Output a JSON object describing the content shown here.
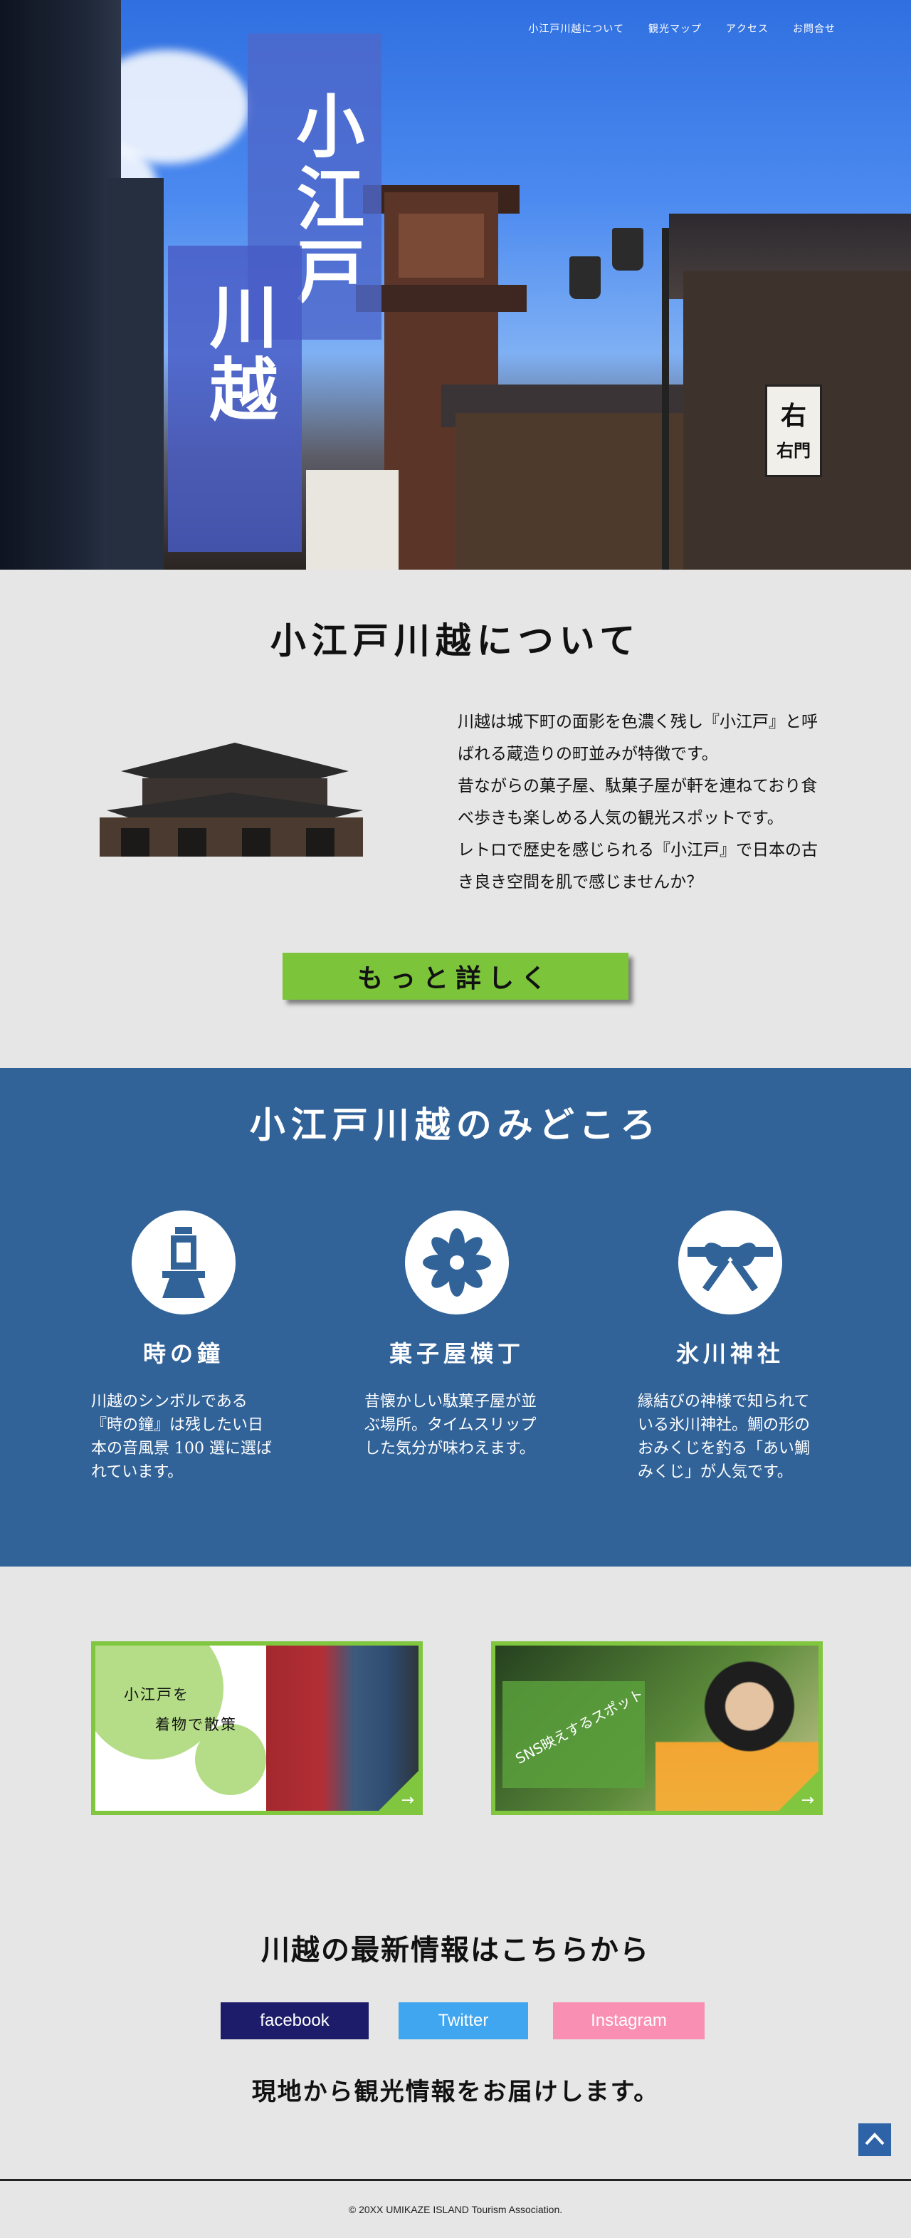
{
  "hero": {
    "title_line1": "小江戸",
    "title_line2": "川越",
    "sign_top": "右",
    "sign_bottom": "右門"
  },
  "nav": {
    "items": [
      "小江戸川越について",
      "観光マップ",
      "アクセス",
      "お問合せ"
    ]
  },
  "about": {
    "title": "小江戸川越について",
    "paragraphs": [
      "川越は城下町の面影を色濃く残し『小江戸』と呼ばれる蔵造りの町並みが特徴です。",
      "昔ながらの菓子屋、駄菓子屋が軒を連ねており食べ歩きも楽しめる人気の観光スポットです。",
      "レトロで歴史を感じられる『小江戸』で日本の古き良き空間を肌で感じませんか？"
    ],
    "more_button": "もっと詳しく"
  },
  "highlights": {
    "title": "小江戸川越のみどころ",
    "spots": [
      {
        "name": "時の鐘",
        "icon": "bell-tower-icon",
        "text": "川越のシンボルである『時の鐘』は残したい日本の音風景 100 選に選ばれています。"
      },
      {
        "name": "菓子屋横丁",
        "icon": "flower-icon",
        "text": "昔懐かしい駄菓子屋が並ぶ場所。タイムスリップした気分が味わえます。"
      },
      {
        "name": "氷川神社",
        "icon": "ribbon-knot-icon",
        "text": "縁結びの神様で知られている氷川神社。鯛の形のおみくじを釣る「あい鯛みくじ」が人気です。"
      }
    ]
  },
  "banners": {
    "left_line1": "小江戸を",
    "left_line2": "着物で散策",
    "right_label": "SNS映えするスポット",
    "arrow": "→"
  },
  "latest": {
    "title": "川越の最新情報はこちらから",
    "facebook": "facebook",
    "twitter": "Twitter",
    "instagram": "Instagram",
    "subtitle": "現地から観光情報をお届けします。",
    "to_top": "^"
  },
  "footer": {
    "copyright": "© 20XX UMIKAZE ISLAND Tourism Association."
  },
  "colors": {
    "accent_green": "#7cc43a",
    "section_blue": "#316399",
    "title_block": "#4e68ca"
  }
}
